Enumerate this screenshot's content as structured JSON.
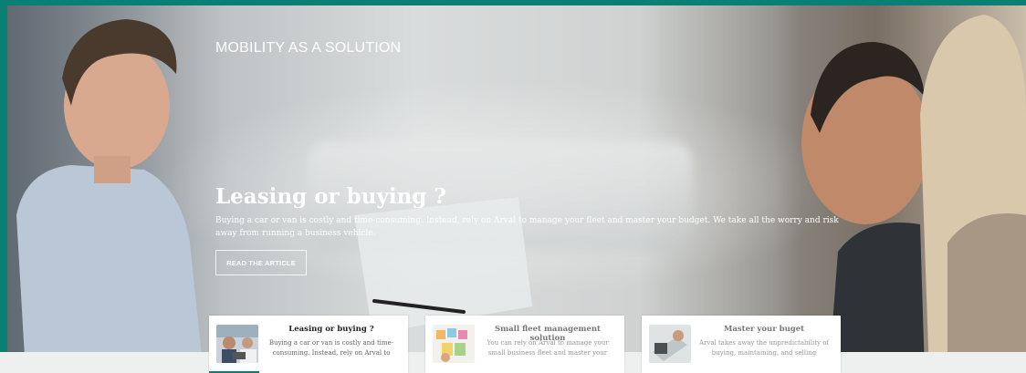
{
  "hero": {
    "kicker": "MOBILITY AS A SOLUTION",
    "headline": "Leasing or buying ?",
    "description": "Buying a car or van is costly and time-consuming. Instead, rely on Arval to manage your fleet and master your budget. We take all the worry and risk away from running a business vehicle.",
    "cta_label": "READ THE ARTICLE"
  },
  "cards": [
    {
      "title": "Leasing or buying ?",
      "text": "Buying a car or van is costly and time-consuming. Instead, rely on Arval to",
      "active": true
    },
    {
      "title": "Small fleet management solution",
      "text": "You can rely on Arval to manage your small business fleet and master your",
      "active": false
    },
    {
      "title": "Master your buget",
      "text": "Arval takes away the unpredictability of buying, maintaining, and selling",
      "active": false
    }
  ],
  "colors": {
    "brand": "#0a7f73"
  },
  "icons": {
    "card_1": "people-laptop-photo",
    "card_2": "colorful-notes-photo",
    "card_3": "calculator-photo"
  }
}
